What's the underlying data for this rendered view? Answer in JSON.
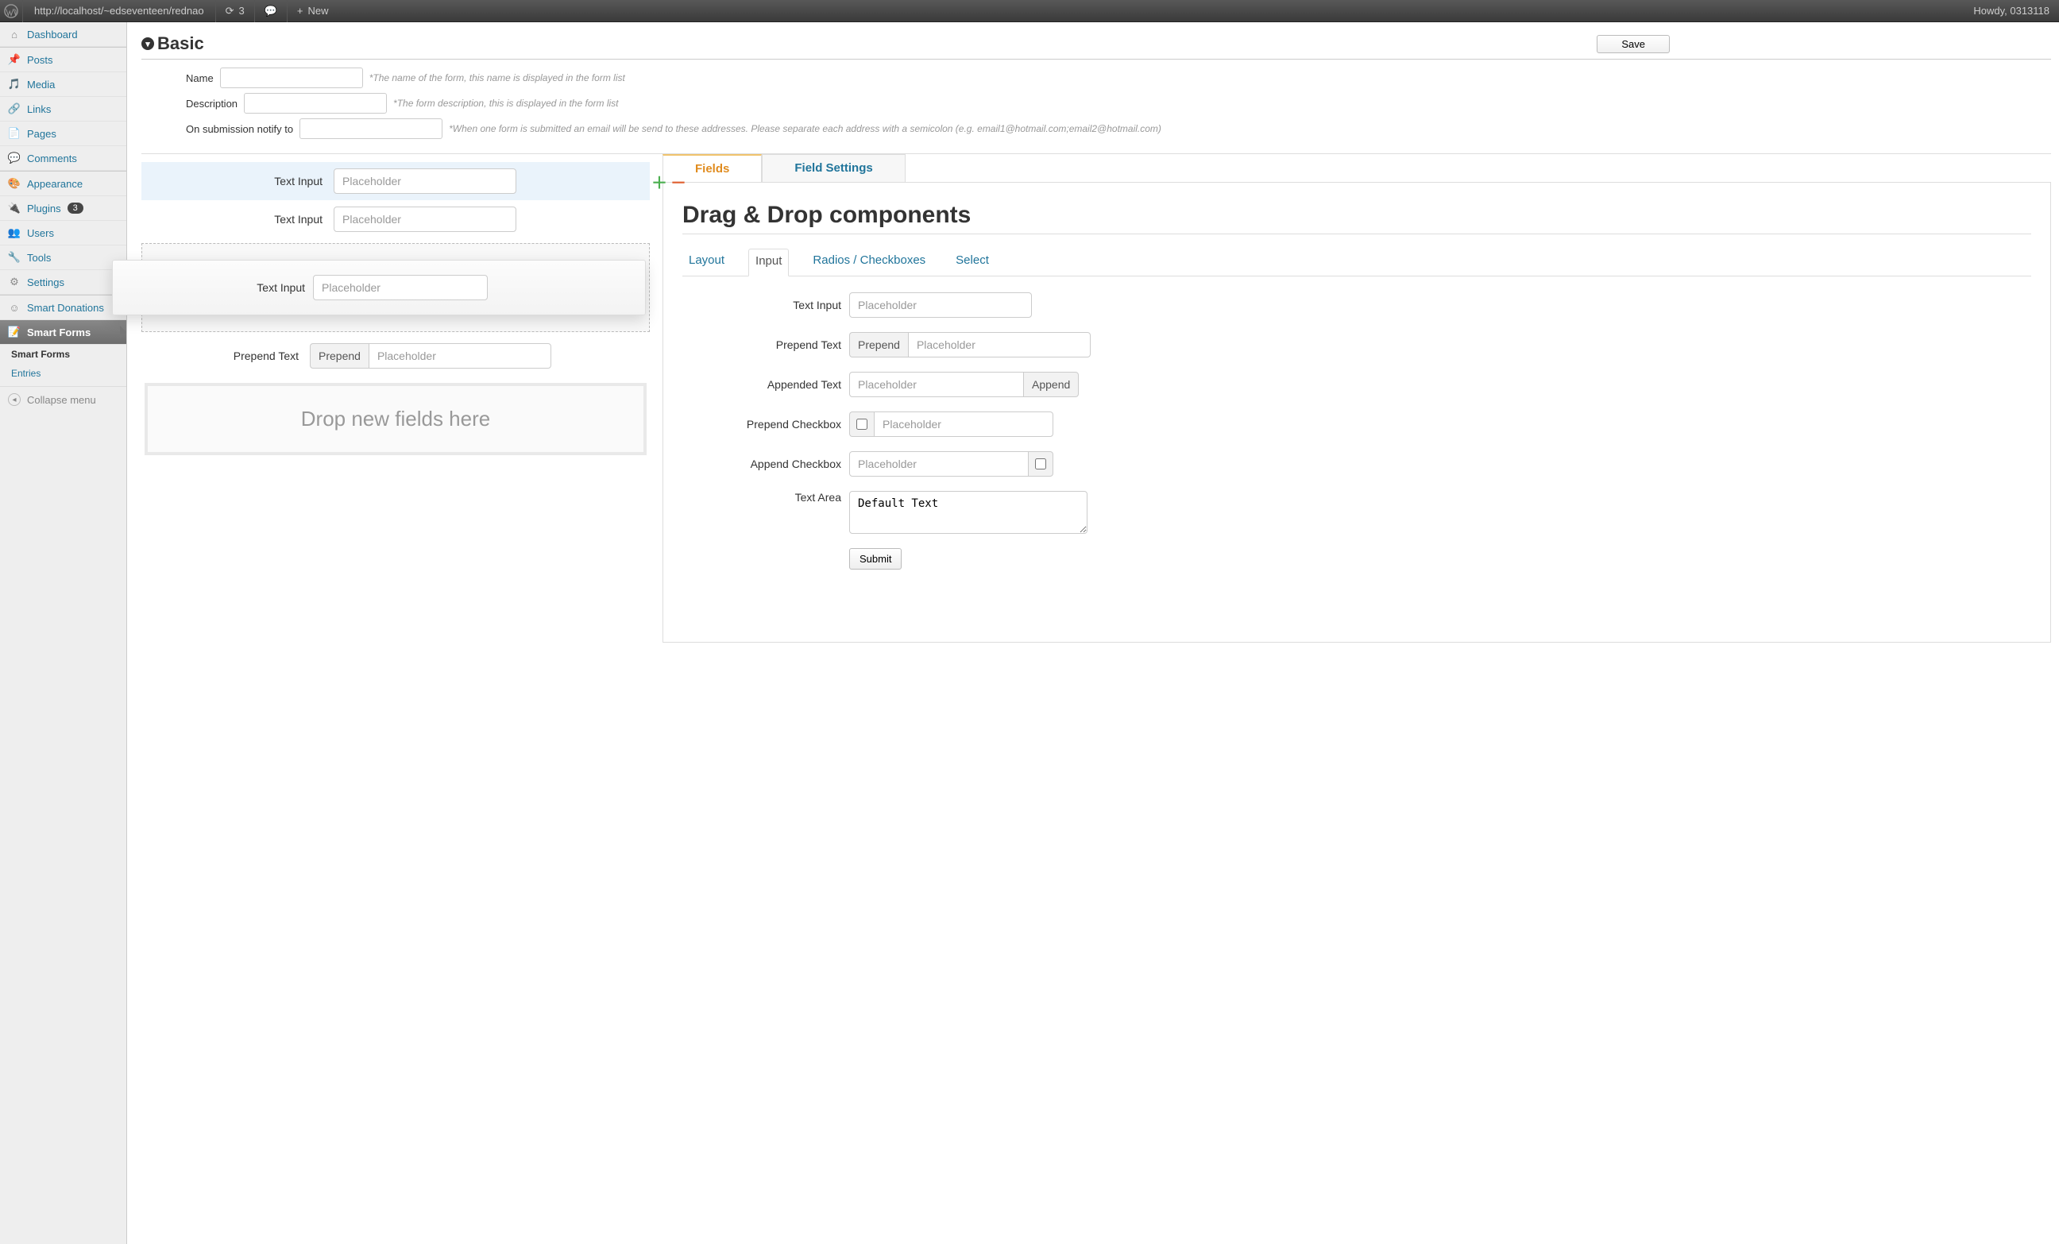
{
  "adminbar": {
    "url": "http://localhost/~edseventeen/rednao",
    "updates_count": "3",
    "new_label": "New",
    "howdy": "Howdy, 0313118"
  },
  "sidebar": {
    "items": [
      {
        "label": "Dashboard",
        "icon": "home"
      },
      {
        "label": "Posts",
        "icon": "pin"
      },
      {
        "label": "Media",
        "icon": "media"
      },
      {
        "label": "Links",
        "icon": "link"
      },
      {
        "label": "Pages",
        "icon": "page"
      },
      {
        "label": "Comments",
        "icon": "comment"
      },
      {
        "label": "Appearance",
        "icon": "appearance"
      },
      {
        "label": "Plugins",
        "icon": "plugin",
        "badge": "3"
      },
      {
        "label": "Users",
        "icon": "users"
      },
      {
        "label": "Tools",
        "icon": "tools"
      },
      {
        "label": "Settings",
        "icon": "settings"
      },
      {
        "label": "Smart Donations",
        "icon": "smiley"
      },
      {
        "label": "Smart Forms",
        "icon": "forms"
      }
    ],
    "submenu": [
      {
        "label": "Smart Forms"
      },
      {
        "label": "Entries"
      }
    ],
    "collapse": "Collapse menu"
  },
  "header": {
    "title": "Basic",
    "save": "Save"
  },
  "settings": {
    "name_label": "Name",
    "name_hint": "*The name of the form, this name is displayed in the form list",
    "desc_label": "Description",
    "desc_hint": "*The form description, this is displayed in the form list",
    "notify_label": "On submission notify to",
    "notify_hint": "*When one form is submitted an email will be send to these addresses. Please separate each address with a semicolon (e.g. email1@hotmail.com;email2@hotmail.com)"
  },
  "canvas": {
    "row1": {
      "label": "Text Input",
      "placeholder": "Placeholder"
    },
    "row2": {
      "label": "Text Input",
      "placeholder": "Placeholder"
    },
    "ghost": {
      "label": "Text Input",
      "placeholder": "Placeholder"
    },
    "row3": {
      "label": "Prepend Text",
      "prepend": "Prepend",
      "placeholder": "Placeholder"
    },
    "dropzone": "Drop new fields here"
  },
  "panel": {
    "tabs": {
      "fields": "Fields",
      "settings": "Field Settings"
    },
    "title": "Drag & Drop components",
    "comp_tabs": {
      "layout": "Layout",
      "input": "Input",
      "radios": "Radios / Checkboxes",
      "select": "Select"
    },
    "components": {
      "text_input": {
        "label": "Text Input",
        "placeholder": "Placeholder"
      },
      "prepend_text": {
        "label": "Prepend Text",
        "addon": "Prepend",
        "placeholder": "Placeholder"
      },
      "appended_text": {
        "label": "Appended Text",
        "addon": "Append",
        "placeholder": "Placeholder"
      },
      "prepend_checkbox": {
        "label": "Prepend Checkbox",
        "placeholder": "Placeholder"
      },
      "append_checkbox": {
        "label": "Append Checkbox",
        "placeholder": "Placeholder"
      },
      "textarea": {
        "label": "Text Area",
        "value": "Default Text"
      },
      "submit": "Submit"
    }
  }
}
